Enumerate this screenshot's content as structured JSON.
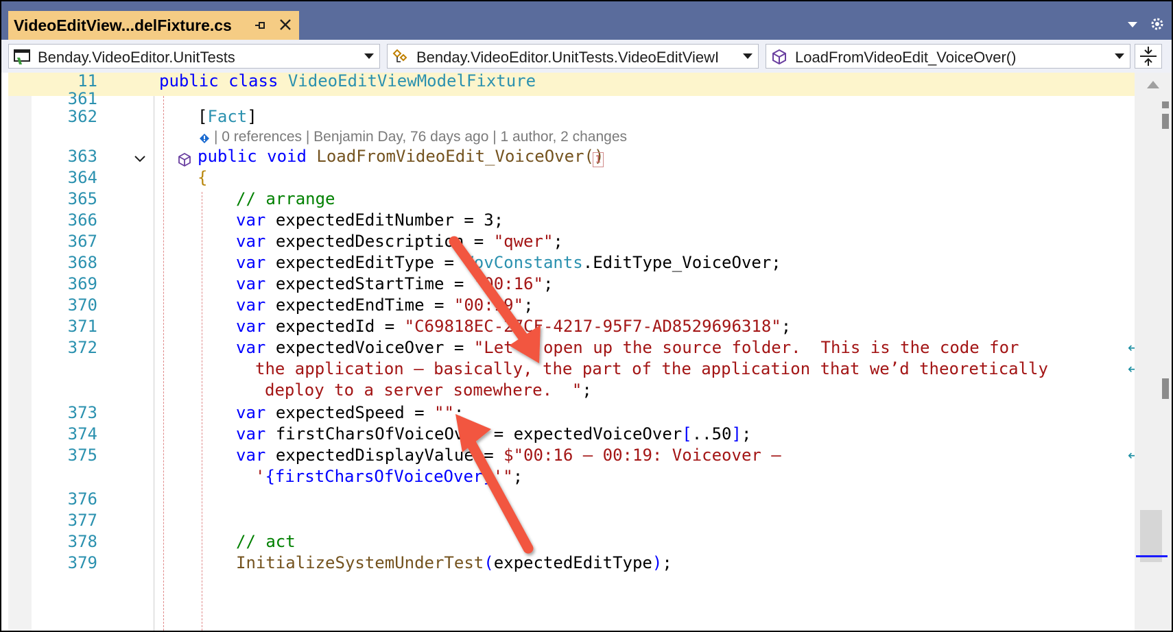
{
  "tab": {
    "title": "VideoEditView...delFixture.cs"
  },
  "navbar": {
    "project": "Benday.VideoEditor.UnitTests",
    "type": "Benday.VideoEditor.UnitTests.VideoEditViewI",
    "member": "LoadFromVideoEdit_VoiceOver()"
  },
  "sticky": {
    "line_number": "11",
    "kw1": "public",
    "kw2": "class",
    "type_name": "VideoEditViewModelFixture"
  },
  "codelens": {
    "references": "0 references",
    "author": "Benjamin Day, 76 days ago",
    "changes": "1 author, 2 changes"
  },
  "method_ref_badge": "1",
  "lines": [
    {
      "num": "361"
    },
    {
      "num": "362",
      "attr_open": "[",
      "attr": "Fact",
      "attr_close": "]"
    },
    {
      "num": "363",
      "kw1": "public",
      "kw2": "void",
      "name": "LoadFromVideoEdit_VoiceOver()"
    },
    {
      "num": "364",
      "text": "{"
    },
    {
      "num": "365",
      "comment": "// arrange"
    },
    {
      "num": "366",
      "kw": "var",
      "text": "expectedEditNumber = 3;"
    },
    {
      "num": "367",
      "kw": "var",
      "text": "expectedDescription = ",
      "str": "\"qwer\"",
      "tail": ";"
    },
    {
      "num": "368",
      "kw": "var",
      "text": "expectedEditType = ",
      "type": "VovConstants",
      "tail": ".EditType_VoiceOver;"
    },
    {
      "num": "369",
      "kw": "var",
      "text": "expectedStartTime = ",
      "str": "\"00:16\"",
      "tail": ";"
    },
    {
      "num": "370",
      "kw": "var",
      "text": "expectedEndTime = ",
      "str": "\"00:19\"",
      "tail": ";"
    },
    {
      "num": "371",
      "kw": "var",
      "text": "expectedId = ",
      "str": "\"C69818EC-27CF-4217-95F7-AD8529696318\"",
      "tail": ";"
    },
    {
      "num": "372",
      "kw": "var",
      "text": "expectedVoiceOver = ",
      "str": "\"Let’s open up the source folder.  This is the code for",
      "wrap1": "the application – basically, the part of the application that we’d theoretically",
      "wrap2": "deploy to a server somewhere.  \"",
      "tail": ";"
    },
    {
      "num": "373",
      "kw": "var",
      "text": "expectedSpeed = ",
      "str": "\"\"",
      "tail": ";"
    },
    {
      "num": "374",
      "kw": "var",
      "text": "firstCharsOfVoiceOver = expectedVoiceOver",
      "br": "[",
      "mid": "..50",
      "br2": "]",
      "tail": ";"
    },
    {
      "num": "375",
      "kw": "var",
      "text": "expectedDisplayValue = ",
      "str": "$\"00:16 – 00:19: Voiceover –",
      "wrap1a": "'",
      "wrap1b": "{firstCharsOfVoiceOver}",
      "wrap1c": "'\"",
      "tail": ";"
    },
    {
      "num": "376"
    },
    {
      "num": "377"
    },
    {
      "num": "378",
      "comment": "// act"
    },
    {
      "num": "379",
      "call": "InitializeSystemUnderTest",
      "p1": "(",
      "arg": "expectedEditType",
      "p2": ")",
      "tail": ";"
    }
  ]
}
